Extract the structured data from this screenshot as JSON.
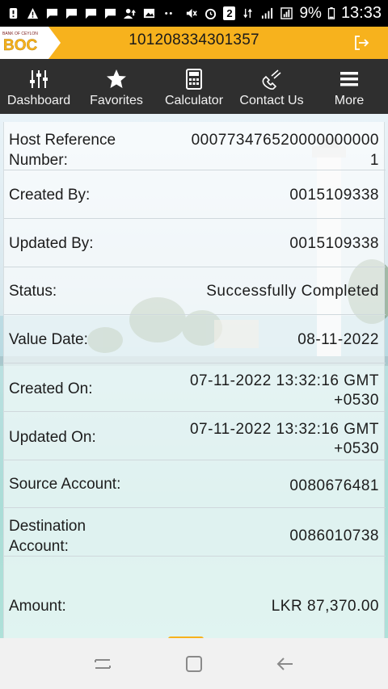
{
  "status_bar": {
    "icons": [
      "notification-icon",
      "warning-icon",
      "message-icon",
      "message-icon",
      "message-icon",
      "message-icon",
      "person-upload-icon",
      "image-icon",
      "more-dots-icon",
      "mute-icon",
      "alarm-icon",
      "sim-2-icon",
      "data-icon",
      "signal-icon",
      "signal-icon",
      "battery-icon"
    ],
    "sim_badge": "2",
    "battery": "9%",
    "time": "13:33"
  },
  "header": {
    "bank_logo": "BOC",
    "bank_name": "BANK OF CEYLON",
    "account_number": "101208334301357",
    "accent": "#f7b21d"
  },
  "nav": [
    {
      "label": "Dashboard",
      "icon": "sliders-icon"
    },
    {
      "label": "Favorites",
      "icon": "star-icon"
    },
    {
      "label": "Calculator",
      "icon": "calculator-icon"
    },
    {
      "label": "Contact Us",
      "icon": "phone-icon"
    },
    {
      "label": "More",
      "icon": "menu-icon"
    }
  ],
  "details": {
    "host_reference": {
      "label_1": "Host Reference",
      "label_2": "Number:",
      "value_1": "000773476520000000000",
      "value_2": "1"
    },
    "created_by": {
      "label": "Created By:",
      "value": "0015109338"
    },
    "updated_by": {
      "label": "Updated By:",
      "value": "0015109338"
    },
    "status": {
      "label": "Status:",
      "value": "Successfully Completed"
    },
    "value_date": {
      "label": "Value Date:",
      "value": "08-11-2022"
    },
    "created_on": {
      "label": "Created On:",
      "value_1": "07-11-2022 13:32:16 GMT",
      "value_2": "+0530"
    },
    "updated_on": {
      "label": "Updated On:",
      "value_1": "07-11-2022 13:32:16 GMT",
      "value_2": "+0530"
    },
    "source_account": {
      "label": "Source Account:",
      "value": "0080676481"
    },
    "destination_account": {
      "label_1": "Destination",
      "label_2": "Account:",
      "value": "0086010738"
    },
    "amount": {
      "label": "Amount:",
      "value": "LKR 87,370.00"
    }
  },
  "system_nav": [
    "recents-icon",
    "home-icon",
    "back-icon"
  ]
}
